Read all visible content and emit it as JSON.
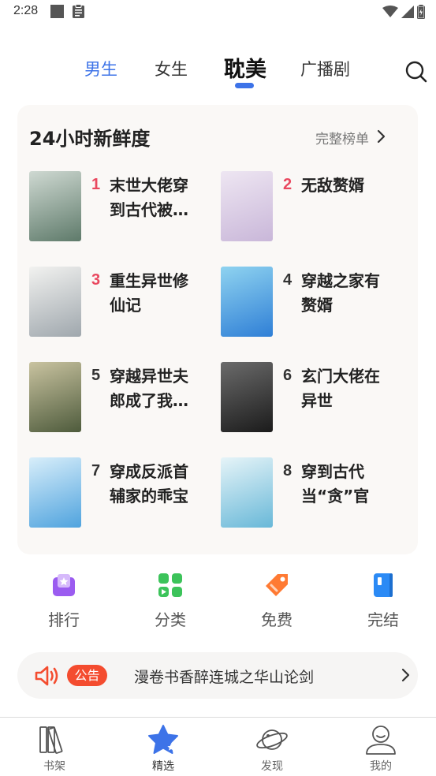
{
  "status_bar": {
    "time": "2:28",
    "icons": [
      "square-notification-icon",
      "clipboard-icon",
      "wifi-icon",
      "signal-icon",
      "battery-icon"
    ]
  },
  "top_tabs": {
    "items": [
      {
        "label": "男生"
      },
      {
        "label": "女生"
      },
      {
        "label": "耽美"
      },
      {
        "label": "广播剧"
      }
    ],
    "active_index": 2,
    "search_icon": "search-icon"
  },
  "ranking": {
    "title": "24小时新鲜度",
    "full_list_label": "完整榜单",
    "books": [
      {
        "rank": "1",
        "title": "末世大佬穿到古代被…",
        "cover_colors": [
          "#5e7a6a",
          "#cfd9d2"
        ]
      },
      {
        "rank": "2",
        "title": "无敌赘婿",
        "cover_colors": [
          "#c9b7d9",
          "#eee6f2"
        ]
      },
      {
        "rank": "3",
        "title": "重生异世修仙记",
        "cover_colors": [
          "#9fa7ad",
          "#f2f2f0"
        ]
      },
      {
        "rank": "4",
        "title": "穿越之家有赘婿",
        "cover_colors": [
          "#2f7fd6",
          "#8fd3f0"
        ]
      },
      {
        "rank": "5",
        "title": "穿越异世夫郎成了我…",
        "cover_colors": [
          "#4e5b3c",
          "#c9c3a0"
        ]
      },
      {
        "rank": "6",
        "title": "玄门大佬在异世",
        "cover_colors": [
          "#1b1b1b",
          "#6b6b6b"
        ]
      },
      {
        "rank": "7",
        "title": "穿成反派首辅家的乖宝",
        "cover_colors": [
          "#4fa3de",
          "#d8eefa"
        ]
      },
      {
        "rank": "8",
        "title": "穿到古代当“贪”官",
        "cover_colors": [
          "#68b8d8",
          "#e6f4f8"
        ]
      }
    ]
  },
  "quick_entries": [
    {
      "label": "排行",
      "icon": "ranking-icon",
      "color": "#9b5cf0"
    },
    {
      "label": "分类",
      "icon": "category-icon",
      "color": "#3cc35a"
    },
    {
      "label": "免费",
      "icon": "free-tag-icon",
      "color": "#ff7a33"
    },
    {
      "label": "完结",
      "icon": "completed-book-icon",
      "color": "#2b8af5"
    }
  ],
  "notice": {
    "badge": "公告",
    "text": "漫卷书香醉连城之华山论剑"
  },
  "bottom_nav": {
    "items": [
      {
        "label": "书架",
        "icon": "bookshelf-icon"
      },
      {
        "label": "精选",
        "icon": "featured-star-icon"
      },
      {
        "label": "发现",
        "icon": "planet-icon"
      },
      {
        "label": "我的",
        "icon": "profile-icon"
      }
    ],
    "active_index": 1
  },
  "colors": {
    "accent": "#3d73e8",
    "hot_rank": "#e9485f",
    "notice_badge": "#f44c2f"
  }
}
